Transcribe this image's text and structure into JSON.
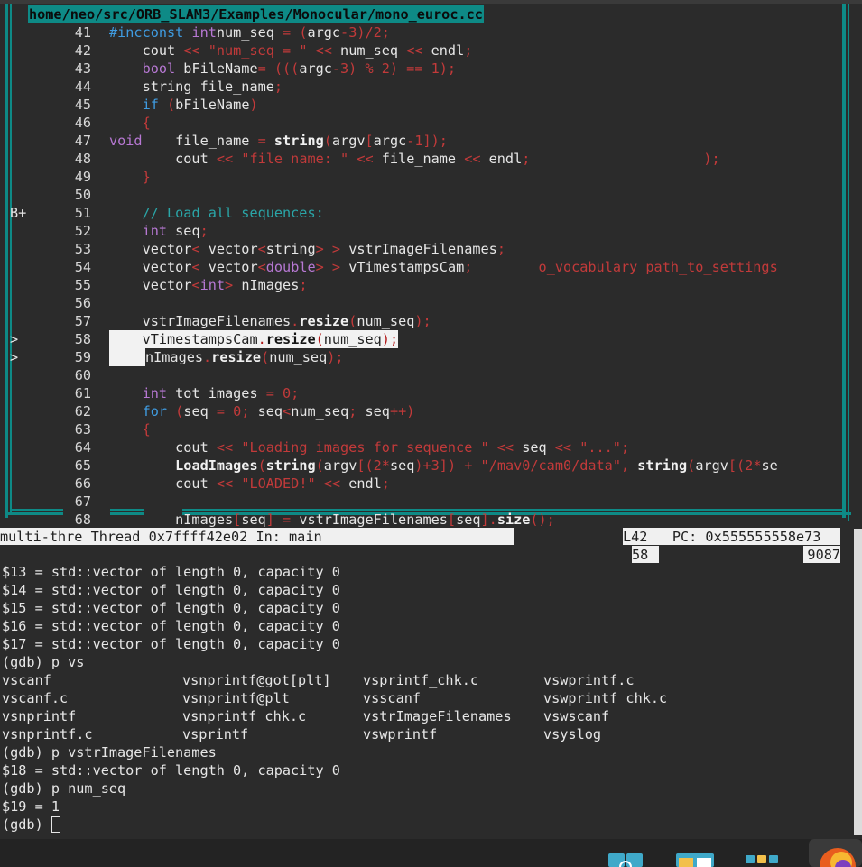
{
  "source_window": {
    "file_path": "home/neo/src/ORB_SLAM3/Examples/Monocular/mono_euroc.cc",
    "lines": [
      {
        "num": "41",
        "bp": "",
        "segments": [
          [
            "kw",
            "#incconst "
          ],
          [
            "ty",
            "int"
          ],
          [
            "",
            "num_seq "
          ],
          [
            "op",
            "= ("
          ],
          [
            "",
            "argc"
          ],
          [
            "op",
            "-3)/2;"
          ]
        ]
      },
      {
        "num": "42",
        "bp": "",
        "segments": [
          [
            "",
            "    cout "
          ],
          [
            "op",
            "<< "
          ],
          [
            "st",
            "\"num_seq = \" "
          ],
          [
            "op",
            "<< "
          ],
          [
            "",
            "num_seq "
          ],
          [
            "op",
            "<< "
          ],
          [
            "",
            "endl"
          ],
          [
            "op",
            ";"
          ]
        ]
      },
      {
        "num": "43",
        "bp": "",
        "segments": [
          [
            "",
            "    "
          ],
          [
            "ty",
            "bool "
          ],
          [
            "",
            "bFileName"
          ],
          [
            "op",
            "= ((("
          ],
          [
            "",
            "argc"
          ],
          [
            "op",
            "-3) % 2) == 1);"
          ]
        ]
      },
      {
        "num": "44",
        "bp": "",
        "segments": [
          [
            "",
            "    string file_name"
          ],
          [
            "op",
            ";"
          ]
        ]
      },
      {
        "num": "45",
        "bp": "",
        "segments": [
          [
            "",
            "    "
          ],
          [
            "kw",
            "if "
          ],
          [
            "op",
            "("
          ],
          [
            "",
            "bFileName"
          ],
          [
            "op",
            ")"
          ]
        ]
      },
      {
        "num": "46",
        "bp": "",
        "segments": [
          [
            "",
            "    "
          ],
          [
            "op",
            "{"
          ]
        ]
      },
      {
        "num": "47",
        "bp": "",
        "segments": [
          [
            "ty",
            "void"
          ],
          [
            "",
            "    file_name "
          ],
          [
            "op",
            "= "
          ],
          [
            "fn",
            "string"
          ],
          [
            "op",
            "("
          ],
          [
            "",
            "argv"
          ],
          [
            "op",
            "["
          ],
          [
            "",
            "argc"
          ],
          [
            "op",
            "-1]);"
          ]
        ]
      },
      {
        "num": "48",
        "bp": "",
        "segments": [
          [
            "",
            "        cout "
          ],
          [
            "op",
            "<< "
          ],
          [
            "st",
            "\"file name: \" "
          ],
          [
            "op",
            "<< "
          ],
          [
            "",
            "file_name "
          ],
          [
            "op",
            "<< "
          ],
          [
            "",
            "endl"
          ],
          [
            "op",
            ";"
          ],
          [
            "",
            "                     "
          ],
          [
            "op",
            ");"
          ]
        ]
      },
      {
        "num": "49",
        "bp": "",
        "segments": [
          [
            "",
            "    "
          ],
          [
            "op",
            "}"
          ]
        ]
      },
      {
        "num": "50",
        "bp": "",
        "segments": []
      },
      {
        "num": "51",
        "bp": "B+",
        "segments": [
          [
            "",
            "    "
          ],
          [
            "cm",
            "// Load all sequences:"
          ]
        ]
      },
      {
        "num": "52",
        "bp": "",
        "segments": [
          [
            "",
            "    "
          ],
          [
            "ty",
            "int "
          ],
          [
            "",
            "seq"
          ],
          [
            "op",
            ";"
          ]
        ]
      },
      {
        "num": "53",
        "bp": "",
        "segments": [
          [
            "",
            "    vector"
          ],
          [
            "op",
            "< "
          ],
          [
            "",
            "vector"
          ],
          [
            "op",
            "<"
          ],
          [
            "",
            "string"
          ],
          [
            "op",
            "> > "
          ],
          [
            "",
            "vstrImageFilenames"
          ],
          [
            "op",
            ";"
          ]
        ]
      },
      {
        "num": "54",
        "bp": "",
        "segments": [
          [
            "",
            "    vector"
          ],
          [
            "op",
            "< "
          ],
          [
            "",
            "vector"
          ],
          [
            "op",
            "<"
          ],
          [
            "ty",
            "double"
          ],
          [
            "op",
            "> > "
          ],
          [
            "",
            "vTimestampsCam"
          ],
          [
            "op",
            ";"
          ],
          [
            "",
            "        "
          ],
          [
            "st",
            "o_vocabulary path_to_settings"
          ]
        ]
      },
      {
        "num": "55",
        "bp": "",
        "segments": [
          [
            "",
            "    vector"
          ],
          [
            "op",
            "<"
          ],
          [
            "ty",
            "int"
          ],
          [
            "op",
            "> "
          ],
          [
            "",
            "nImages"
          ],
          [
            "op",
            ";"
          ]
        ]
      },
      {
        "num": "56",
        "bp": "",
        "segments": []
      },
      {
        "num": "57",
        "bp": "",
        "segments": [
          [
            "",
            "    vstrImageFilenames"
          ],
          [
            "op",
            "."
          ],
          [
            "fn",
            "resize"
          ],
          [
            "op",
            "("
          ],
          [
            "",
            "num_seq"
          ],
          [
            "op",
            ");"
          ]
        ]
      },
      {
        "num": "58",
        "bp": ">",
        "highlight": "full",
        "segments": [
          [
            "",
            "    vTimestampsCam"
          ],
          [
            "op",
            "."
          ],
          [
            "fn",
            "resize"
          ],
          [
            "op",
            "("
          ],
          [
            "",
            "num_seq"
          ],
          [
            "op",
            ");"
          ]
        ]
      },
      {
        "num": "59",
        "bp": ">",
        "highlight": "indent",
        "segments": [
          [
            "",
            "    "
          ],
          [
            "",
            "nImages"
          ],
          [
            "op",
            "."
          ],
          [
            "fn",
            "resize"
          ],
          [
            "op",
            "("
          ],
          [
            "",
            "num_seq"
          ],
          [
            "op",
            ");"
          ]
        ]
      },
      {
        "num": "60",
        "bp": "",
        "segments": []
      },
      {
        "num": "61",
        "bp": "",
        "segments": [
          [
            "",
            "    "
          ],
          [
            "ty",
            "int "
          ],
          [
            "",
            "tot_images "
          ],
          [
            "op",
            "= 0;"
          ]
        ]
      },
      {
        "num": "62",
        "bp": "",
        "segments": [
          [
            "",
            "    "
          ],
          [
            "kw",
            "for "
          ],
          [
            "op",
            "("
          ],
          [
            "",
            "seq "
          ],
          [
            "op",
            "= 0; "
          ],
          [
            "",
            "seq"
          ],
          [
            "op",
            "<"
          ],
          [
            "",
            "num_seq"
          ],
          [
            "op",
            "; "
          ],
          [
            "",
            "seq"
          ],
          [
            "op",
            "++)"
          ]
        ]
      },
      {
        "num": "63",
        "bp": "",
        "segments": [
          [
            "",
            "    "
          ],
          [
            "op",
            "{"
          ]
        ]
      },
      {
        "num": "64",
        "bp": "",
        "segments": [
          [
            "",
            "        cout "
          ],
          [
            "op",
            "<< "
          ],
          [
            "st",
            "\"Loading images for sequence \" "
          ],
          [
            "op",
            "<< "
          ],
          [
            "",
            "seq "
          ],
          [
            "op",
            "<< "
          ],
          [
            "st",
            "\"...\""
          ],
          [
            "op",
            ";"
          ]
        ]
      },
      {
        "num": "65",
        "bp": "",
        "segments": [
          [
            "",
            "        "
          ],
          [
            "fn",
            "LoadImages"
          ],
          [
            "op",
            "("
          ],
          [
            "fn",
            "string"
          ],
          [
            "op",
            "("
          ],
          [
            "",
            "argv"
          ],
          [
            "op",
            "[(2*"
          ],
          [
            "",
            "seq"
          ],
          [
            "op",
            ")+3]) + "
          ],
          [
            "st",
            "\"/mav0/cam0/data\""
          ],
          [
            "op",
            ", "
          ],
          [
            "fn",
            "string"
          ],
          [
            "op",
            "("
          ],
          [
            "",
            "argv"
          ],
          [
            "op",
            "[(2*"
          ],
          [
            "",
            "se"
          ]
        ]
      },
      {
        "num": "66",
        "bp": "",
        "segments": [
          [
            "",
            "        cout "
          ],
          [
            "op",
            "<< "
          ],
          [
            "st",
            "\"LOADED!\" "
          ],
          [
            "op",
            "<< "
          ],
          [
            "",
            "endl"
          ],
          [
            "op",
            ";"
          ]
        ]
      },
      {
        "num": "67",
        "bp": "",
        "segments": []
      },
      {
        "num": "68",
        "bp": "",
        "segments": [
          [
            "",
            "        nImages"
          ],
          [
            "op",
            "["
          ],
          [
            "",
            "seq"
          ],
          [
            "op",
            "] = "
          ],
          [
            "",
            "vstrImageFilenames"
          ],
          [
            "op",
            "["
          ],
          [
            "",
            "seq"
          ],
          [
            "op",
            "]."
          ],
          [
            "fn",
            "size"
          ],
          [
            "op",
            "();"
          ]
        ]
      }
    ]
  },
  "status_bar": {
    "left": "multi-thre Thread 0x7ffff42e02 In: main",
    "right": "L42   PC: 0x555555558e73",
    "right_line2_left": "58",
    "right_line2_right": "9087"
  },
  "gdb_console": {
    "outputs": [
      "$13 = std::vector of length 0, capacity 0",
      "$14 = std::vector of length 0, capacity 0",
      "$15 = std::vector of length 0, capacity 0",
      "$16 = std::vector of length 0, capacity 0",
      "$17 = std::vector of length 0, capacity 0"
    ],
    "cmd1": "(gdb) p vs",
    "completions": [
      [
        "vscanf",
        "vsnprintf@got[plt]",
        "vsprintf_chk.c",
        "vswprintf.c"
      ],
      [
        "vscanf.c",
        "vsnprintf@plt",
        "vsscanf",
        "vswprintf_chk.c"
      ],
      [
        "vsnprintf",
        "vsnprintf_chk.c",
        "vstrImageFilenames",
        "vswscanf"
      ],
      [
        "vsnprintf.c",
        "vsprintf",
        "vswprintf",
        "vsyslog"
      ]
    ],
    "cmd2": "(gdb) p vstrImageFilenames",
    "out2": "$18 = std::vector of length 0, capacity 0",
    "cmd3": "(gdb) p num_seq",
    "out3": "$19 = 1",
    "prompt": "(gdb) "
  },
  "colors": {
    "frame": "#0e8a86",
    "background": "#2b2b2b",
    "keyword": "#3f9be0",
    "type": "#b778d3",
    "operator": "#c23a3a",
    "comment": "#2aa6a8"
  },
  "taskbar": {
    "icons": [
      "network-icon",
      "file-manager-icon",
      "apps-grid-icon",
      "firefox-icon"
    ]
  }
}
